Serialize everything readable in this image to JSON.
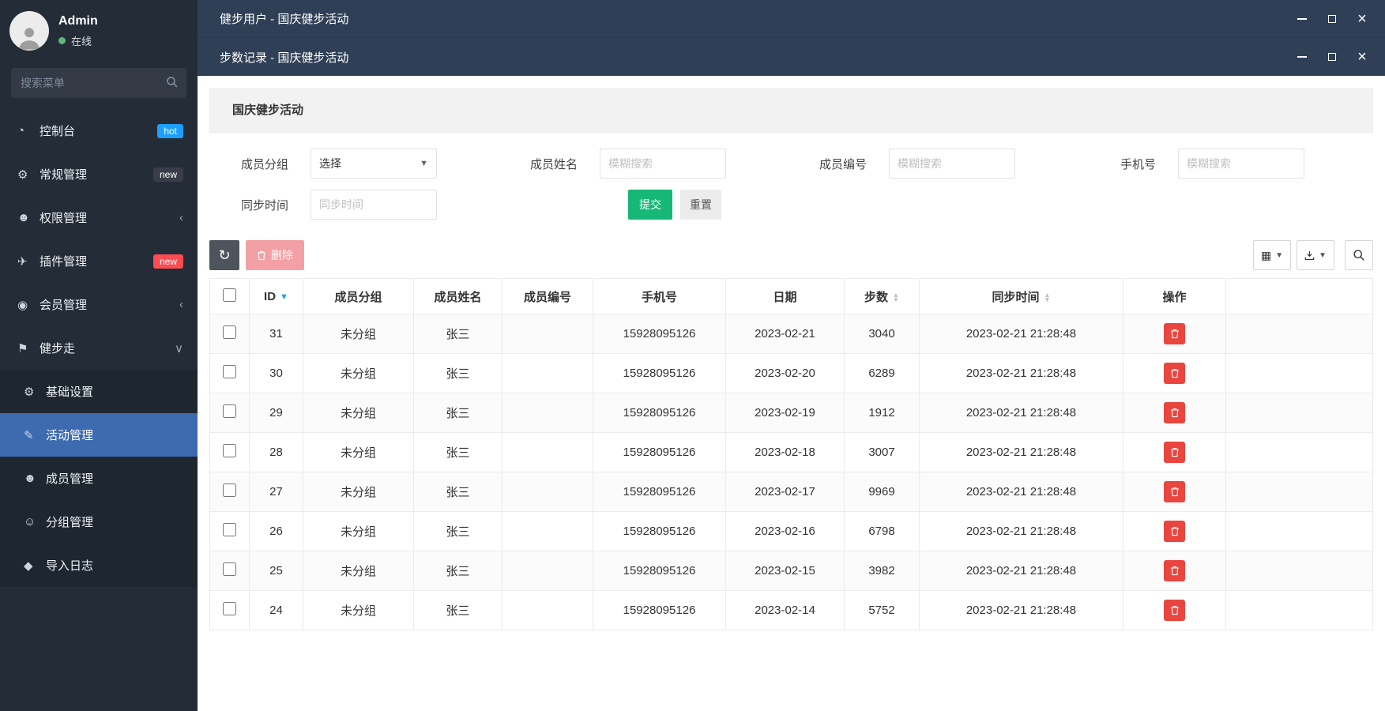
{
  "colors": {
    "titlebar": "#2F4056",
    "sidebar_bg": "#242C37",
    "submenu_bg": "#1E2630",
    "active_item": "#3E6AB0",
    "accent_blue": "#1E9FFF",
    "green": "#16B777",
    "danger_red": "#E8463F",
    "delete_muted": "#F2A0A5",
    "online_green": "#5FB878"
  },
  "sidebar": {
    "user": {
      "name": "Admin",
      "status": "在线"
    },
    "search": {
      "placeholder": "搜索菜单"
    },
    "menu": [
      {
        "label": "控制台",
        "glyph": "◔",
        "icon": "dashboard-icon",
        "badge": "hot",
        "badge_color": "#1E9FFF"
      },
      {
        "label": "常规管理",
        "glyph": "⚙",
        "icon": "gears-icon",
        "badge": "new",
        "badge_color": "#393D49"
      },
      {
        "label": "权限管理",
        "glyph": "☻",
        "icon": "users-icon",
        "arrow": "‹"
      },
      {
        "label": "插件管理",
        "glyph": "✈",
        "icon": "plane-icon",
        "badge": "new",
        "badge_color": "#FF4C52"
      },
      {
        "label": "会员管理",
        "glyph": "◉",
        "icon": "user-icon",
        "arrow": "‹"
      },
      {
        "label": "健步走",
        "glyph": "⚑",
        "icon": "location-icon",
        "arrow": "∨"
      }
    ],
    "submenu": [
      {
        "label": "基础设置",
        "glyph": "⚙",
        "icon": "settings-icon"
      },
      {
        "label": "活动管理",
        "glyph": "✎",
        "icon": "activity-icon",
        "state": "active"
      },
      {
        "label": "成员管理",
        "glyph": "☻",
        "icon": "member-icon"
      },
      {
        "label": "分组管理",
        "glyph": "☺",
        "icon": "groups-icon"
      },
      {
        "label": "导入日志",
        "glyph": "◆",
        "icon": "import-log-icon"
      }
    ]
  },
  "windows": [
    {
      "title": "健步用户 - 国庆健步活动"
    },
    {
      "title": "步数记录 - 国庆健步活动"
    }
  ],
  "panel": {
    "title": "国庆健步活动"
  },
  "filters": {
    "group_label": "成员分组",
    "group_value": "选择",
    "name_label": "成员姓名",
    "name_placeholder": "模糊搜索",
    "code_label": "成员编号",
    "code_placeholder": "模糊搜索",
    "phone_label": "手机号",
    "phone_placeholder": "模糊搜索",
    "sync_label": "同步时间",
    "sync_placeholder": "同步时间",
    "submit_label": "提交",
    "reset_label": "重置"
  },
  "toolbar": {
    "delete_label": "删除"
  },
  "table": {
    "columns": [
      "ID",
      "成员分组",
      "成员姓名",
      "成员编号",
      "手机号",
      "日期",
      "步数",
      "同步时间",
      "操作"
    ],
    "rows": [
      {
        "id": "31",
        "group": "未分组",
        "name": "张三",
        "code": "",
        "phone": "15928095126",
        "date": "2023-02-21",
        "steps": "3040",
        "sync": "2023-02-21 21:28:48"
      },
      {
        "id": "30",
        "group": "未分组",
        "name": "张三",
        "code": "",
        "phone": "15928095126",
        "date": "2023-02-20",
        "steps": "6289",
        "sync": "2023-02-21 21:28:48"
      },
      {
        "id": "29",
        "group": "未分组",
        "name": "张三",
        "code": "",
        "phone": "15928095126",
        "date": "2023-02-19",
        "steps": "1912",
        "sync": "2023-02-21 21:28:48"
      },
      {
        "id": "28",
        "group": "未分组",
        "name": "张三",
        "code": "",
        "phone": "15928095126",
        "date": "2023-02-18",
        "steps": "3007",
        "sync": "2023-02-21 21:28:48"
      },
      {
        "id": "27",
        "group": "未分组",
        "name": "张三",
        "code": "",
        "phone": "15928095126",
        "date": "2023-02-17",
        "steps": "9969",
        "sync": "2023-02-21 21:28:48"
      },
      {
        "id": "26",
        "group": "未分组",
        "name": "张三",
        "code": "",
        "phone": "15928095126",
        "date": "2023-02-16",
        "steps": "6798",
        "sync": "2023-02-21 21:28:48"
      },
      {
        "id": "25",
        "group": "未分组",
        "name": "张三",
        "code": "",
        "phone": "15928095126",
        "date": "2023-02-15",
        "steps": "3982",
        "sync": "2023-02-21 21:28:48"
      },
      {
        "id": "24",
        "group": "未分组",
        "name": "张三",
        "code": "",
        "phone": "15928095126",
        "date": "2023-02-14",
        "steps": "5752",
        "sync": "2023-02-21 21:28:48"
      }
    ]
  }
}
